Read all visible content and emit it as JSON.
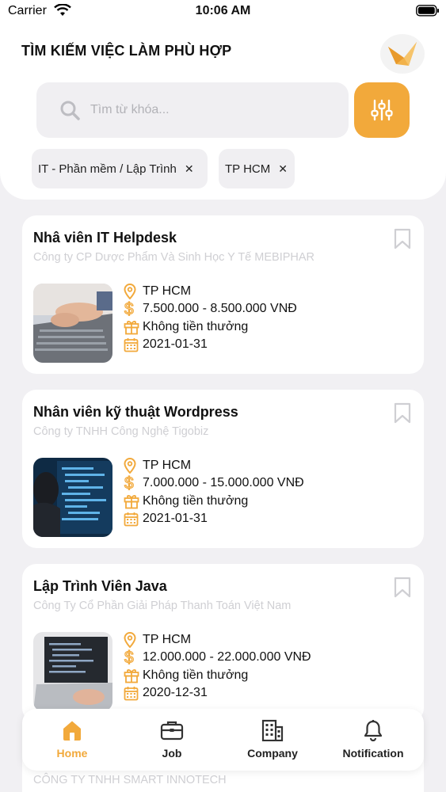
{
  "status_bar": {
    "carrier": "Carrier",
    "time": "10:06 AM"
  },
  "header": {
    "title": "TÌM KIẾM VIỆC LÀM PHÙ HỢP",
    "search_placeholder": "Tìm từ khóa..."
  },
  "filters": [
    {
      "label": "IT - Phần mềm / Lập Trình",
      "remove": "✕"
    },
    {
      "label": "TP HCM",
      "remove": "✕"
    }
  ],
  "jobs": [
    {
      "title": "Nhâ viên IT Helpdesk",
      "company": "Công ty CP Dược Phẩm Và Sinh Học Y Tế MEBIPHAR",
      "location": "TP HCM",
      "salary": "7.500.000 - 8.500.000 VNĐ",
      "bonus": "Không tiền thưởng",
      "date": "2021-01-31"
    },
    {
      "title": "Nhân viên kỹ thuật Wordpress",
      "company": "Công ty TNHH Công Nghệ Tigobiz",
      "location": "TP HCM",
      "salary": "7.000.000 - 15.000.000 VNĐ",
      "bonus": "Không tiền thưởng",
      "date": "2021-01-31"
    },
    {
      "title": "Lập Trình Viên Java",
      "company": "Công Ty Cổ Phần Giải Pháp Thanh Toán Việt Nam",
      "location": "TP HCM",
      "salary": "12.000.000 - 22.000.000 VNĐ",
      "bonus": "Không tiền thưởng",
      "date": "2020-12-31"
    }
  ],
  "peek_company": "CÔNG TY TNHH SMART INNOTECH",
  "nav": [
    {
      "label": "Home",
      "icon": "home-icon",
      "active": true
    },
    {
      "label": "Job",
      "icon": "briefcase-icon",
      "active": false
    },
    {
      "label": "Company",
      "icon": "building-icon",
      "active": false
    },
    {
      "label": "Notification",
      "icon": "bell-icon",
      "active": false
    }
  ],
  "colors": {
    "accent": "#f2a93b",
    "background": "#f1f0f3",
    "muted_text": "#cfcfd3"
  }
}
